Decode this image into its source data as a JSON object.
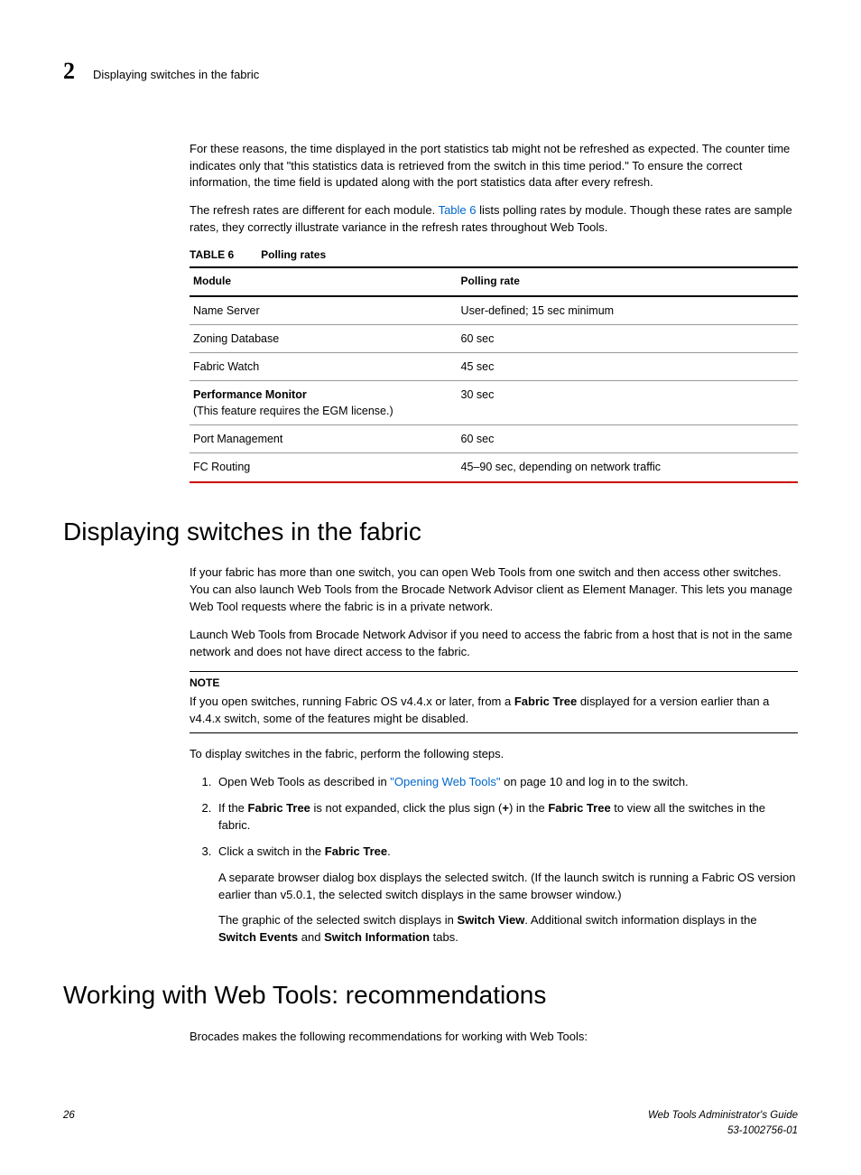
{
  "header": {
    "chapter_number": "2",
    "title": "Displaying switches in the fabric"
  },
  "intro": {
    "para1": "For these reasons, the time displayed in the port statistics tab might not be refreshed as expected. The counter time indicates only that \"this statistics data is retrieved from the switch in this time period.\" To ensure the correct information, the time field is updated along with the port statistics data after every refresh.",
    "para2a": "The refresh rates are different for each module. ",
    "para2_link": "Table 6",
    "para2b": " lists polling rates by module. Though these rates are sample rates, they correctly illustrate variance in the refresh rates throughout Web Tools."
  },
  "table": {
    "caption_label": "TABLE 6",
    "caption_title": "Polling rates",
    "head_module": "Module",
    "head_rate": "Polling rate",
    "rows": [
      {
        "module": "Name Server",
        "sub": "",
        "rate": "User-defined; 15 sec minimum"
      },
      {
        "module": "Zoning Database",
        "sub": "",
        "rate": "60 sec"
      },
      {
        "module": "Fabric Watch",
        "sub": "",
        "rate": "45 sec"
      },
      {
        "module": "Performance Monitor",
        "sub": "(This feature requires the EGM license.)",
        "rate": "30 sec"
      },
      {
        "module": "Port Management",
        "sub": "",
        "rate": "60 sec"
      },
      {
        "module": "FC Routing",
        "sub": "",
        "rate": "45–90 sec, depending on network traffic"
      }
    ]
  },
  "section1": {
    "heading": "Displaying switches in the fabric",
    "para1": "If your fabric has more than one switch, you can open Web Tools from one switch and then access other switches. You can also launch Web Tools from the Brocade Network Advisor client as Element Manager. This lets you manage Web Tool requests where the fabric is in a private network.",
    "para2": "Launch Web Tools from Brocade Network Advisor if you need to access the fabric from a host that is not in the same network and does not have direct access to the fabric.",
    "note_label": "NOTE",
    "note_a": "If you open switches, running Fabric OS v4.4.x or later, from a ",
    "note_bold": "Fabric Tree",
    "note_b": " displayed for a version earlier than a v4.4.x switch, some of the features might be disabled.",
    "para3": "To display switches in the fabric, perform the following steps.",
    "steps": {
      "s1a": "Open Web Tools as described in ",
      "s1_link": "\"Opening Web Tools\"",
      "s1b": " on page 10 and log in to the switch.",
      "s2a": "If the ",
      "s2_bold1": "Fabric Tree",
      "s2b": " is not expanded, click the plus sign (",
      "s2_bold2": "+",
      "s2c": ") in the ",
      "s2_bold3": "Fabric Tree",
      "s2d": " to view all the switches in the fabric.",
      "s3a": "Click a switch in the ",
      "s3_bold1": "Fabric Tree",
      "s3b": ".",
      "s3_p1": "A separate browser dialog box displays the selected switch. (If the launch switch is running a Fabric OS version earlier than v5.0.1, the selected switch displays in the same browser window.)",
      "s3_p2a": "The graphic of the selected switch displays in ",
      "s3_p2_bold1": "Switch View",
      "s3_p2b": ". Additional switch information displays in the ",
      "s3_p2_bold2": "Switch Events",
      "s3_p2c": " and ",
      "s3_p2_bold3": "Switch Information",
      "s3_p2d": " tabs."
    }
  },
  "section2": {
    "heading": "Working with Web Tools: recommendations",
    "para1": "Brocades makes the following recommendations for working with Web Tools:"
  },
  "footer": {
    "page": "26",
    "guide": "Web Tools Administrator's Guide",
    "docnum": "53-1002756-01"
  }
}
